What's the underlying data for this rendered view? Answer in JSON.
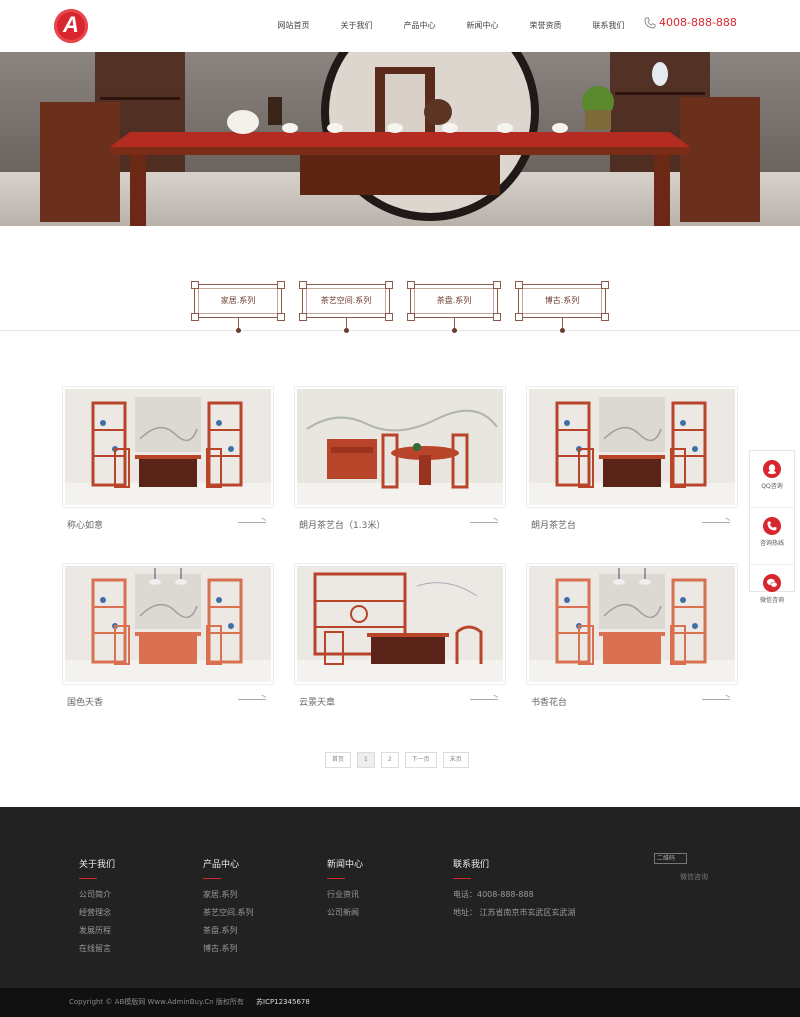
{
  "header": {
    "logo_letter": "A",
    "nav": [
      "网站首页",
      "关于我们",
      "产品中心",
      "新闻中心",
      "荣誉资质",
      "联系我们"
    ],
    "phone": "4008-888-888"
  },
  "tabs": [
    "家居.系列",
    "茶艺空间.系列",
    "茶盘.系列",
    "博古.系列"
  ],
  "products": [
    {
      "name": "称心如意",
      "variant": "a"
    },
    {
      "name": "朗月茶艺台（1.3米）",
      "variant": "b"
    },
    {
      "name": "朗月茶艺台",
      "variant": "a"
    },
    {
      "name": "国色天香",
      "variant": "c"
    },
    {
      "name": "云景天章",
      "variant": "d"
    },
    {
      "name": "书香花台",
      "variant": "c"
    }
  ],
  "pagination": {
    "first": "首页",
    "pages": [
      "1",
      "2"
    ],
    "next": "下一页",
    "last": "末页"
  },
  "side": {
    "qq": "QQ咨询",
    "tel": "咨询热线",
    "wechat": "微信咨询"
  },
  "footer": {
    "about": {
      "title": "关于我们",
      "links": [
        "公司简介",
        "经营理念",
        "发展历程",
        "在线留言"
      ]
    },
    "products": {
      "title": "产品中心",
      "links": [
        "家居.系列",
        "茶艺空间.系列",
        "茶盘.系列",
        "博古.系列"
      ]
    },
    "news": {
      "title": "新闻中心",
      "links": [
        "行业资讯",
        "公司新闻"
      ]
    },
    "contact": {
      "title": "联系我们",
      "phone": "电话：4008-888-888",
      "address": "地址：  江苏省南京市玄武区玄武湖"
    },
    "qr_alt": "二维码",
    "qr_label": "微信咨询",
    "copyright": "Copyright © AB模版网 Www.AdminBuy.Cn 版权所有",
    "icp": "苏ICP12345678"
  },
  "colors": {
    "brand": "#d8262e",
    "wood": "#6b3b2e",
    "footer": "#222222"
  }
}
